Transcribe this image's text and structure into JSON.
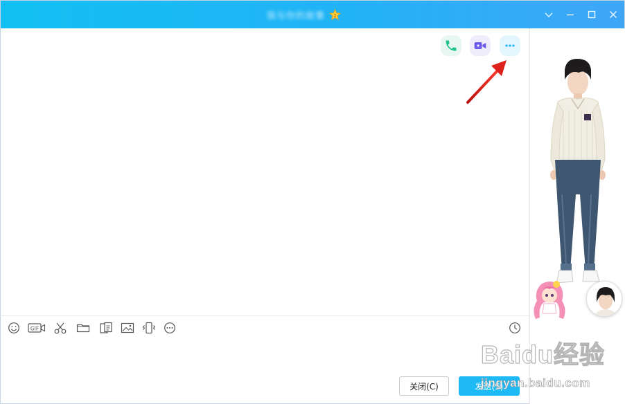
{
  "window": {
    "title": "我与你的故事",
    "brand_color": "#1ebaf5"
  },
  "annotation": {
    "arrow_color": "#e0201a"
  },
  "toolbar": {
    "items": [
      {
        "icon": "emoji-icon"
      },
      {
        "icon": "gif-icon",
        "label": "GIF"
      },
      {
        "icon": "scissors-icon"
      },
      {
        "icon": "folder-icon"
      },
      {
        "icon": "doc-transfer-icon"
      },
      {
        "icon": "image-icon"
      },
      {
        "icon": "shake-icon"
      },
      {
        "icon": "more-icon"
      },
      {
        "icon": "history-clock-icon"
      }
    ]
  },
  "buttons": {
    "close_label": "关闭(C)",
    "send_label": "发送(S)"
  },
  "watermark": {
    "brand": "Baidu经验",
    "sub": "jingyan.baidu.com"
  }
}
